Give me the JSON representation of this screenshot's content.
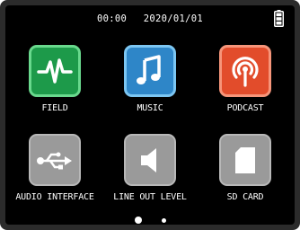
{
  "status": {
    "time": "00:00",
    "date": "2020/01/01",
    "battery_icon": "battery-full-icon"
  },
  "apps": [
    {
      "label": "FIELD",
      "icon": "waveform-icon",
      "color": "#1d9a4a"
    },
    {
      "label": "MUSIC",
      "icon": "music-note-icon",
      "color": "#2e86c8"
    },
    {
      "label": "PODCAST",
      "icon": "podcast-icon",
      "color": "#e24c2b"
    },
    {
      "label": "AUDIO INTERFACE",
      "icon": "usb-icon",
      "color": "#9a9a9a"
    },
    {
      "label": "LINE OUT LEVEL",
      "icon": "speaker-icon",
      "color": "#9a9a9a"
    },
    {
      "label": "SD CARD",
      "icon": "sd-card-icon",
      "color": "#9a9a9a"
    }
  ],
  "pager": {
    "pages": 2,
    "current": 1
  }
}
